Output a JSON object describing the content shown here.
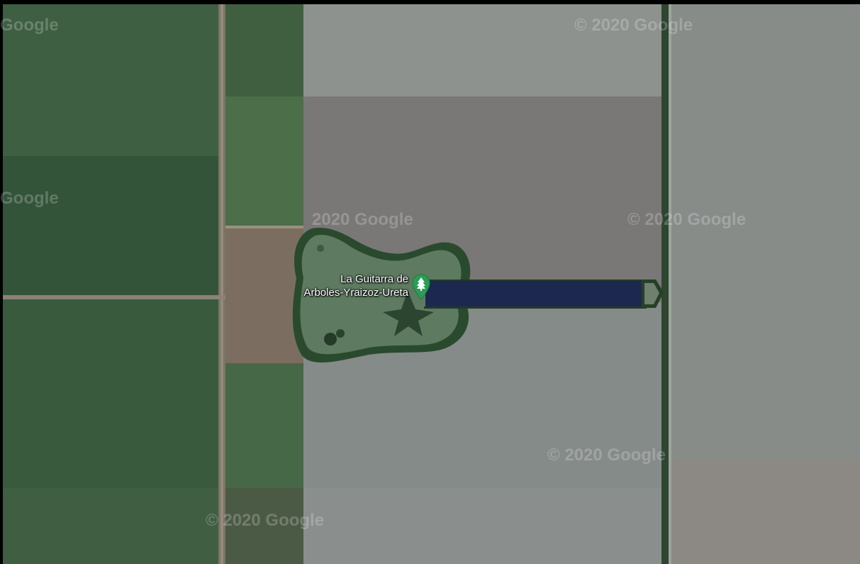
{
  "map": {
    "type": "satellite",
    "watermarks": [
      "Google",
      "© 2020 Google",
      "Google",
      "2020 Google",
      "© 2020 Google",
      "© 2020 Google",
      "© 2020 Google"
    ],
    "place": {
      "name": "La Guitarra de Arboles-Yraizoz-Ureta",
      "line1": "La Guitarra de",
      "line2": "Arboles-Yraizoz-Ureta",
      "icon": "tree-pin-icon",
      "pin_color": "#2a9d55"
    },
    "colors": {
      "dark_field": "#3a5a3b",
      "light_field": "#8a8e8a",
      "tree_line": "#1f3b24",
      "guitar_neck": "#1e2a52"
    }
  }
}
